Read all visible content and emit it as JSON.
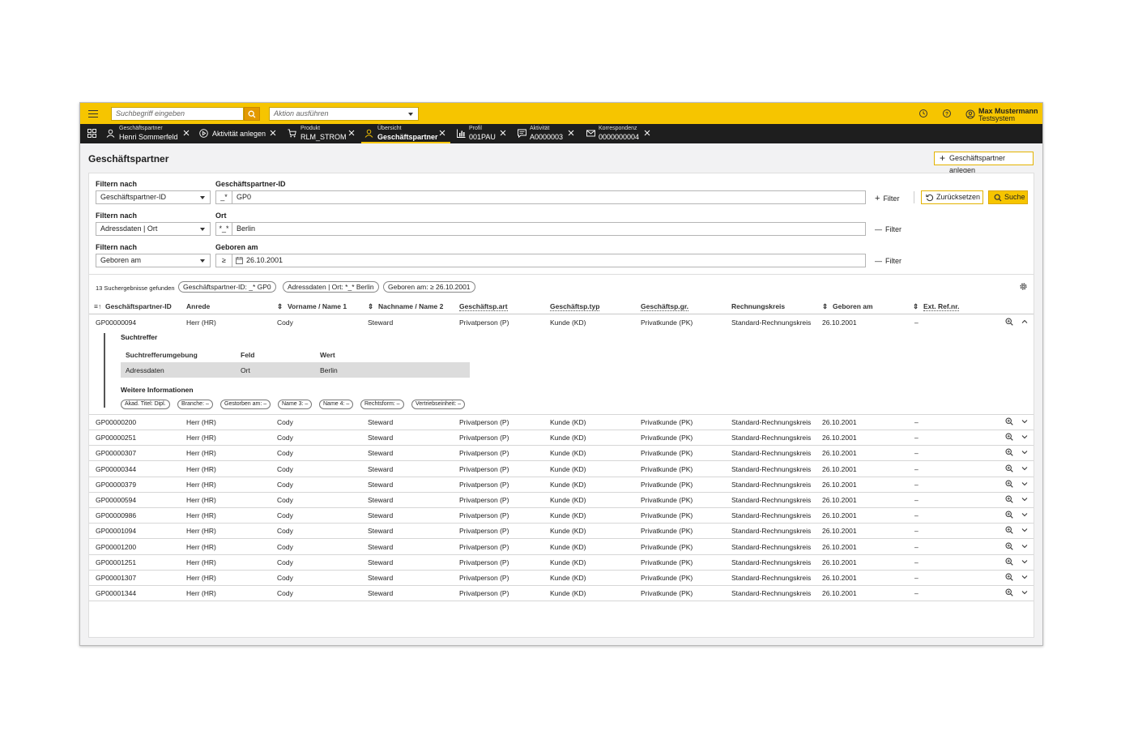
{
  "topbar": {
    "search_placeholder": "Suchbegriff eingeben",
    "action_placeholder": "Aktion ausführen",
    "user_name": "Max Mustermann",
    "user_system": "Testsystem"
  },
  "tabs": [
    {
      "small": "Geschäftspartner",
      "big": "Henri Sommerfeld",
      "icon": "person-icon"
    },
    {
      "single": "Aktivität anlegen",
      "icon": "play-icon"
    },
    {
      "small": "Produkt",
      "big": "RLM_STROM",
      "icon": "cart-icon"
    },
    {
      "small": "Übersicht",
      "big": "Geschäftspartner",
      "icon": "person-icon",
      "active": true
    },
    {
      "small": "Profil",
      "big": "001PAU",
      "icon": "chart-icon"
    },
    {
      "small": "Aktivität",
      "big": "A0000003",
      "icon": "message-icon"
    },
    {
      "small": "Korrespondenz",
      "big": "0000000004",
      "icon": "mail-icon"
    }
  ],
  "page": {
    "title": "Geschäftspartner",
    "create_button": "Geschäftspartner anlegen"
  },
  "filters": [
    {
      "label": "Filtern nach",
      "select": "Geschäftspartner-ID",
      "field_label": "Geschäftspartner-ID",
      "op": "_*",
      "value": "GP0",
      "action": "Filter",
      "action_icon": "+"
    },
    {
      "label": "Filtern nach",
      "select": "Adressdaten | Ort",
      "field_label": "Ort",
      "op": "*_*",
      "value": "Berlin",
      "action": "Filter",
      "action_icon": "—"
    },
    {
      "label": "Filtern nach",
      "select": "Geboren am",
      "field_label": "Geboren am",
      "op": "≥",
      "value": "26.10.2001",
      "action": "Filter",
      "action_icon": "—"
    }
  ],
  "buttons": {
    "reset": "Zurücksetzen",
    "search": "Suche"
  },
  "results": {
    "count": "13 Suchergebnisse gefunden",
    "chips": [
      "Geschäftspartner-ID: _* GP0",
      "Adressdaten | Ort: *_* Berlin",
      "Geboren am: ≥ 26.10.2001"
    ]
  },
  "columns": [
    "Geschäftspartner-ID",
    "Anrede",
    "Vorname / Name 1",
    "Nachname / Name 2",
    "Geschäftsp.art",
    "Geschäftsp.typ",
    "Geschäftsp.gr.",
    "Rechnungskreis",
    "Geboren am",
    "Ext. Ref.nr."
  ],
  "rows": [
    [
      "GP00000094",
      "Herr (HR)",
      "Cody",
      "Steward",
      "Privatperson (P)",
      "Kunde (KD)",
      "Privatkunde (PK)",
      "Standard-Rechnungskreis",
      "26.10.2001",
      "–"
    ],
    [
      "GP00000200",
      "Herr (HR)",
      "Cody",
      "Steward",
      "Privatperson (P)",
      "Kunde (KD)",
      "Privatkunde (PK)",
      "Standard-Rechnungskreis",
      "26.10.2001",
      "–"
    ],
    [
      "GP00000251",
      "Herr (HR)",
      "Cody",
      "Steward",
      "Privatperson (P)",
      "Kunde (KD)",
      "Privatkunde (PK)",
      "Standard-Rechnungskreis",
      "26.10.2001",
      "–"
    ],
    [
      "GP00000307",
      "Herr (HR)",
      "Cody",
      "Steward",
      "Privatperson (P)",
      "Kunde (KD)",
      "Privatkunde (PK)",
      "Standard-Rechnungskreis",
      "26.10.2001",
      "–"
    ],
    [
      "GP00000344",
      "Herr (HR)",
      "Cody",
      "Steward",
      "Privatperson (P)",
      "Kunde (KD)",
      "Privatkunde (PK)",
      "Standard-Rechnungskreis",
      "26.10.2001",
      "–"
    ],
    [
      "GP00000379",
      "Herr (HR)",
      "Cody",
      "Steward",
      "Privatperson (P)",
      "Kunde (KD)",
      "Privatkunde (PK)",
      "Standard-Rechnungskreis",
      "26.10.2001",
      "–"
    ],
    [
      "GP00000594",
      "Herr (HR)",
      "Cody",
      "Steward",
      "Privatperson (P)",
      "Kunde (KD)",
      "Privatkunde (PK)",
      "Standard-Rechnungskreis",
      "26.10.2001",
      "–"
    ],
    [
      "GP00000986",
      "Herr (HR)",
      "Cody",
      "Steward",
      "Privatperson (P)",
      "Kunde (KD)",
      "Privatkunde (PK)",
      "Standard-Rechnungskreis",
      "26.10.2001",
      "–"
    ],
    [
      "GP00001094",
      "Herr (HR)",
      "Cody",
      "Steward",
      "Privatperson (P)",
      "Kunde (KD)",
      "Privatkunde (PK)",
      "Standard-Rechnungskreis",
      "26.10.2001",
      "–"
    ],
    [
      "GP00001200",
      "Herr (HR)",
      "Cody",
      "Steward",
      "Privatperson (P)",
      "Kunde (KD)",
      "Privatkunde (PK)",
      "Standard-Rechnungskreis",
      "26.10.2001",
      "–"
    ],
    [
      "GP00001251",
      "Herr (HR)",
      "Cody",
      "Steward",
      "Privatperson (P)",
      "Kunde (KD)",
      "Privatkunde (PK)",
      "Standard-Rechnungskreis",
      "26.10.2001",
      "–"
    ],
    [
      "GP00001307",
      "Herr (HR)",
      "Cody",
      "Steward",
      "Privatperson (P)",
      "Kunde (KD)",
      "Privatkunde (PK)",
      "Standard-Rechnungskreis",
      "26.10.2001",
      "–"
    ],
    [
      "GP00001344",
      "Herr (HR)",
      "Cody",
      "Steward",
      "Privatperson (P)",
      "Kunde (KD)",
      "Privatkunde (PK)",
      "Standard-Rechnungskreis",
      "26.10.2001",
      "–"
    ]
  ],
  "expanded": {
    "title": "Suchtreffer",
    "headers": [
      "Suchtrefferumgebung",
      "Feld",
      "Wert"
    ],
    "values": [
      "Adressdaten",
      "Ort",
      "Berlin"
    ],
    "more_title": "Weitere Informationen",
    "pills": [
      "Akad. Titel: Dipl.",
      "Branche: –",
      "Gestorben am: –",
      "Name 3: –",
      "Name 4: –",
      "Rechtsform: –",
      "Vertriebseinheit: –"
    ]
  },
  "colors": {
    "accent": "#f6c500",
    "tabbar": "#1e1e1e",
    "search_button": "#e39a00"
  }
}
